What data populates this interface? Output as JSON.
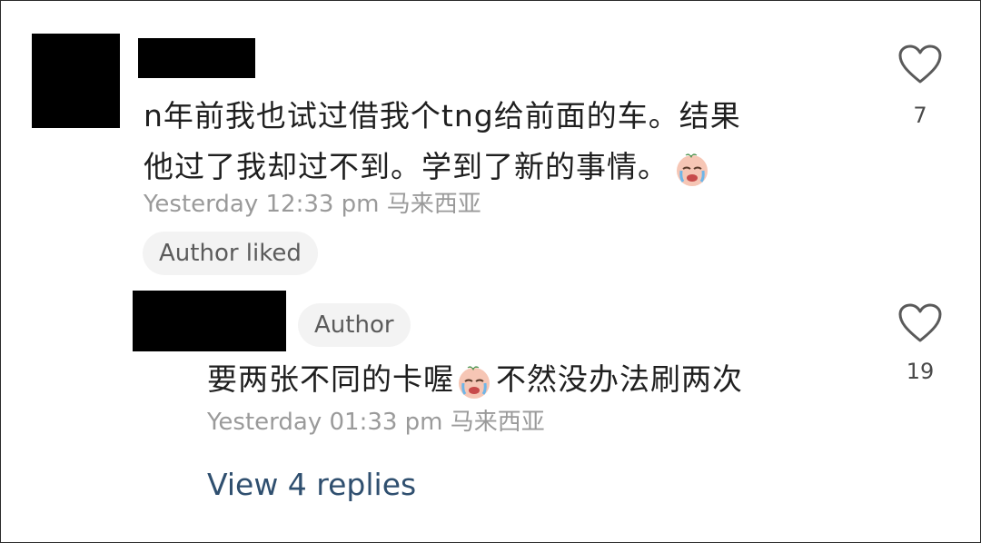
{
  "comments": [
    {
      "text_line1": "n年前我也试过借我个tng给前面的车。结果",
      "text_line2": "他过了我却过不到。学到了新的事情。",
      "emoji": "crying-face-emoji",
      "timestamp": "Yesterday 12:33 pm 马来西亚",
      "badge": "Author liked",
      "like_count": "7",
      "icon": "heart-outline-icon"
    }
  ],
  "reply": {
    "author_badge": "Author",
    "text_before_emoji": "要两张不同的卡喔",
    "emoji": "crying-face-emoji",
    "text_after_emoji": "不然没办法刷两次",
    "timestamp": "Yesterday 01:33 pm 马来西亚",
    "like_count": "19",
    "icon": "heart-outline-icon"
  },
  "view_replies_label": "View 4 replies",
  "colors": {
    "text": "#1f1f1f",
    "meta": "#9a9a9a",
    "link": "#2f4f6f",
    "badge_bg": "#f3f3f3"
  }
}
